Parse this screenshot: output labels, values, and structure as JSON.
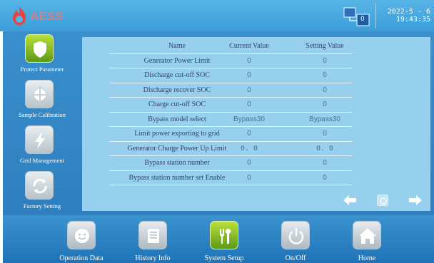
{
  "header": {
    "brand": "AESS",
    "device_badge": "0",
    "date": "2022-5 - 6",
    "time": "19:43:35"
  },
  "sidebar": {
    "items": [
      {
        "label": "Protect Parameter",
        "icon": "shield-icon",
        "active": true
      },
      {
        "label": "Sample Calibration",
        "icon": "crosshair-icon",
        "active": false
      },
      {
        "label": "Grid Management",
        "icon": "lightning-icon",
        "active": false
      },
      {
        "label": "Factory Setting",
        "icon": "refresh-icon",
        "active": false
      }
    ]
  },
  "table": {
    "headers": {
      "name": "Name",
      "current": "Current Value",
      "setting": "Setting Value"
    },
    "rows": [
      {
        "name": "Generator Power Limit",
        "current": "0",
        "setting": "0"
      },
      {
        "name": "Discharge cut-off SOC",
        "current": "0",
        "setting": "0"
      },
      {
        "name": "Discharge recover SOC",
        "current": "0",
        "setting": "0"
      },
      {
        "name": "Charge cut-off SOC",
        "current": "0",
        "setting": "0"
      },
      {
        "name": "Bypass model select",
        "current": "Bypass30",
        "setting": "Bypass30"
      },
      {
        "name": "Limit power exporting to grid",
        "current": "0",
        "setting": "0"
      },
      {
        "name": "Generator Charge Power Up Limit",
        "current": "0. 0",
        "setting": "0. 0"
      },
      {
        "name": "Bypass station number",
        "current": "0",
        "setting": "0"
      },
      {
        "name": "Bypass station number set Enable",
        "current": "0",
        "setting": "0"
      }
    ]
  },
  "pager": {
    "prev_icon": "arrow-left-icon",
    "home_icon": "page-icon",
    "next_icon": "arrow-right-icon"
  },
  "bottom_nav": {
    "items": [
      {
        "label": "Operation Data",
        "icon": "smiley-icon",
        "active": false
      },
      {
        "label": "History Info",
        "icon": "document-icon",
        "active": false
      },
      {
        "label": "System Setup",
        "icon": "tools-icon",
        "active": true
      },
      {
        "label": "On/Off",
        "icon": "power-icon",
        "active": false
      },
      {
        "label": "Home",
        "icon": "home-icon",
        "active": false
      }
    ]
  },
  "colors": {
    "accent_green": "#7dbb22",
    "header_blue": "#4aa9e0",
    "panel_blue": "#96d0ec"
  }
}
